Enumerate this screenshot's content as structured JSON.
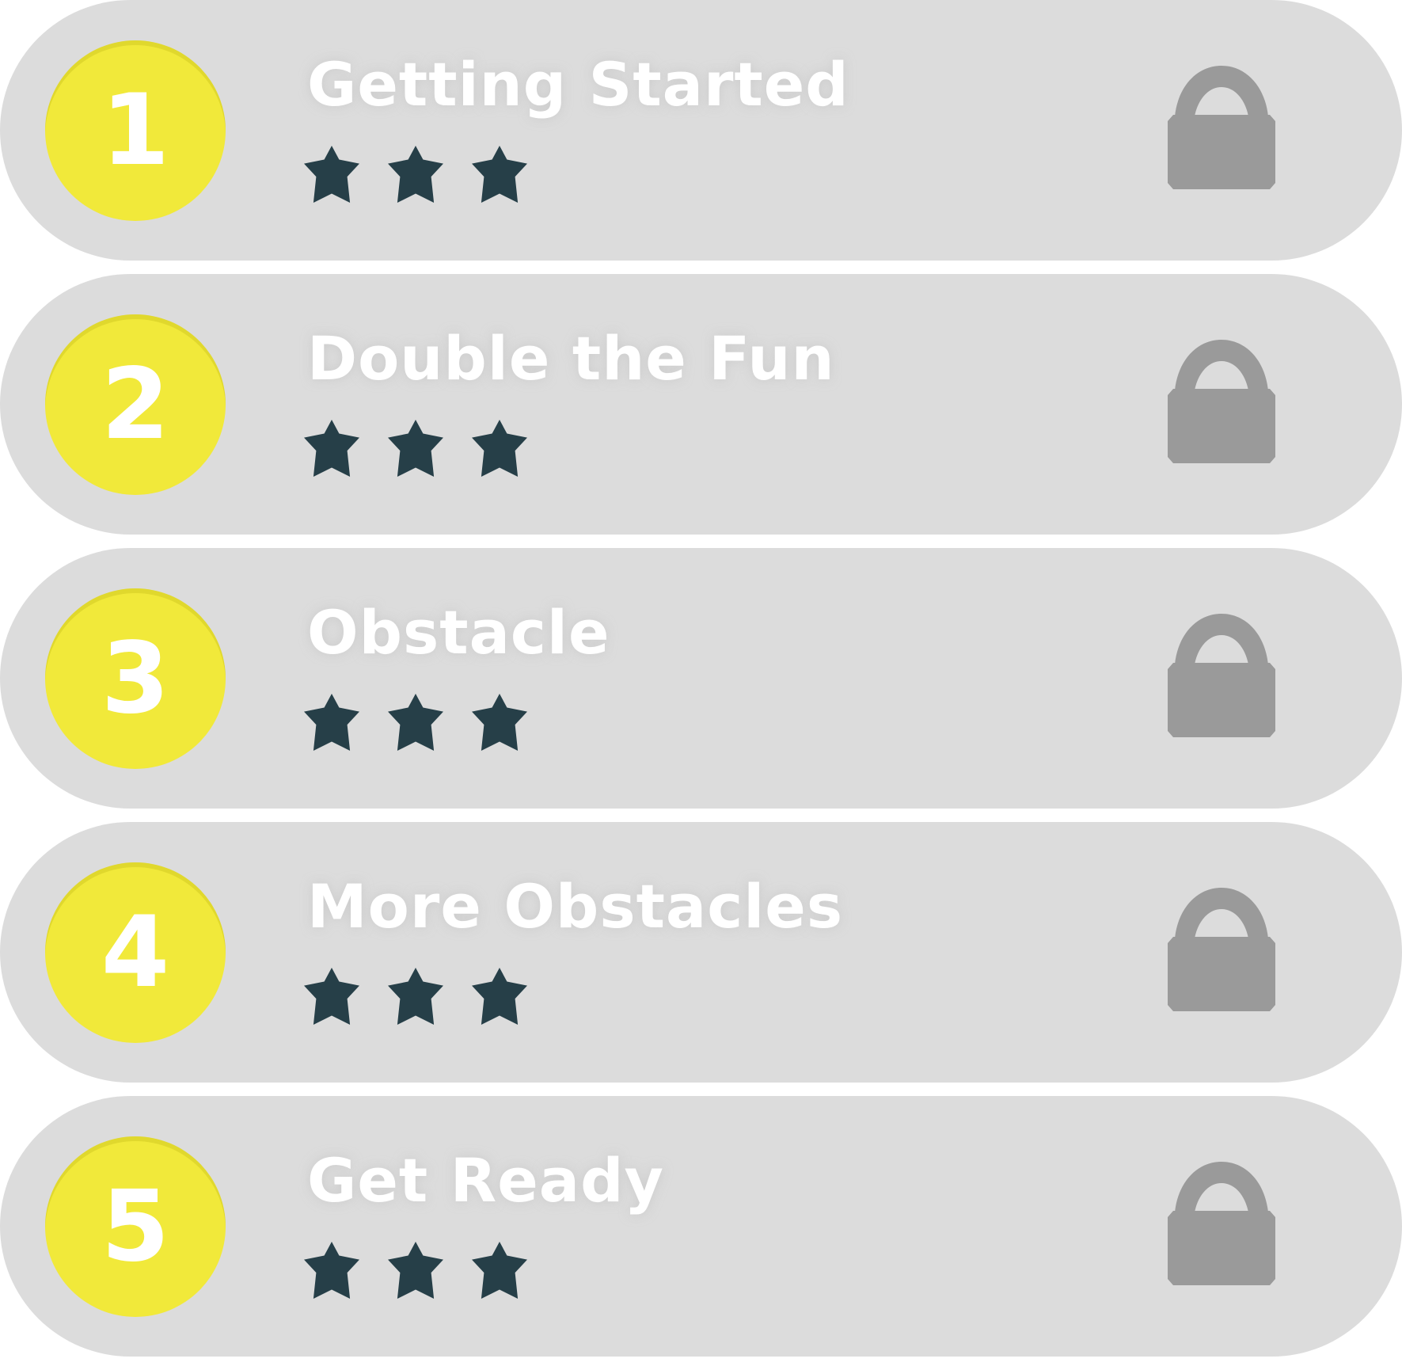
{
  "colors": {
    "row_background": "#dcdcdc",
    "badge": "#f1e93a",
    "text": "#ffffff",
    "star": "#263f48",
    "lock": "#9a9a9a"
  },
  "levels": [
    {
      "number": "1",
      "title": "Getting Started",
      "stars": 3,
      "locked": true,
      "star_icon": "star-icon",
      "lock_icon": "padlock-icon"
    },
    {
      "number": "2",
      "title": "Double the Fun",
      "stars": 3,
      "locked": true,
      "star_icon": "star-icon",
      "lock_icon": "padlock-icon"
    },
    {
      "number": "3",
      "title": "Obstacle",
      "stars": 3,
      "locked": true,
      "star_icon": "star-icon",
      "lock_icon": "padlock-icon"
    },
    {
      "number": "4",
      "title": "More Obstacles",
      "stars": 3,
      "locked": true,
      "star_icon": "star-icon",
      "lock_icon": "padlock-icon"
    },
    {
      "number": "5",
      "title": "Get Ready",
      "stars": 3,
      "locked": true,
      "star_icon": "star-icon",
      "lock_icon": "padlock-icon"
    }
  ]
}
